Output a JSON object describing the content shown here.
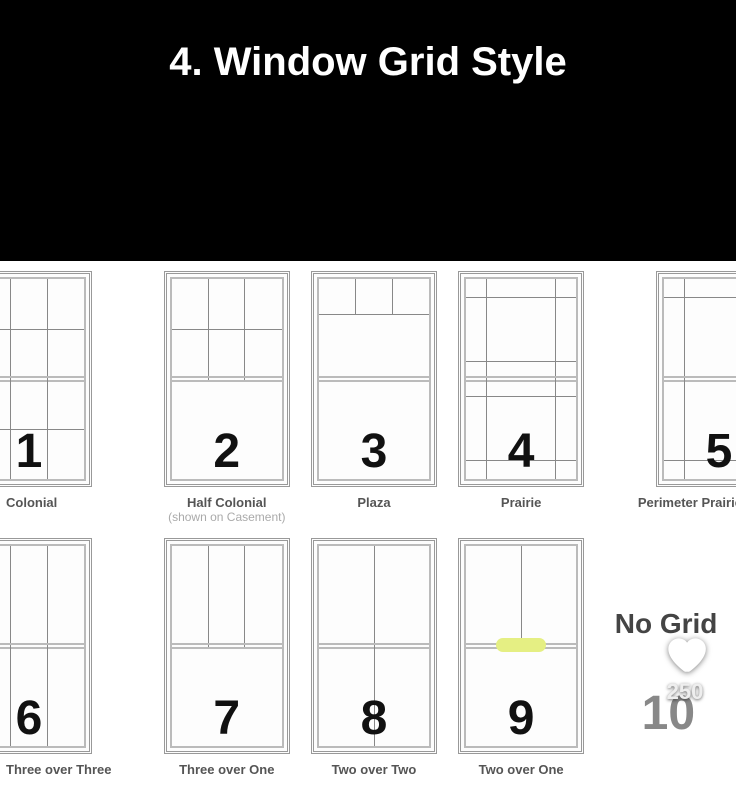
{
  "title": "4. Window Grid Style",
  "like_count": "250",
  "row1": [
    {
      "num": "1",
      "label": "Colonial",
      "sub": ""
    },
    {
      "num": "2",
      "label": "Half Colonial",
      "sub": "(shown on Casement)"
    },
    {
      "num": "3",
      "label": "Plaza",
      "sub": ""
    },
    {
      "num": "4",
      "label": "Prairie",
      "sub": ""
    },
    {
      "num": "5",
      "label": "Perimeter Prairie",
      "sub": ""
    }
  ],
  "row2": [
    {
      "num": "6",
      "label": "Three over Three",
      "sub": ""
    },
    {
      "num": "7",
      "label": "Three over One",
      "sub": ""
    },
    {
      "num": "8",
      "label": "Two over Two",
      "sub": ""
    },
    {
      "num": "9",
      "label": "Two over One",
      "sub": ""
    },
    {
      "num": "10",
      "label": "No Grid",
      "sub": ""
    }
  ]
}
